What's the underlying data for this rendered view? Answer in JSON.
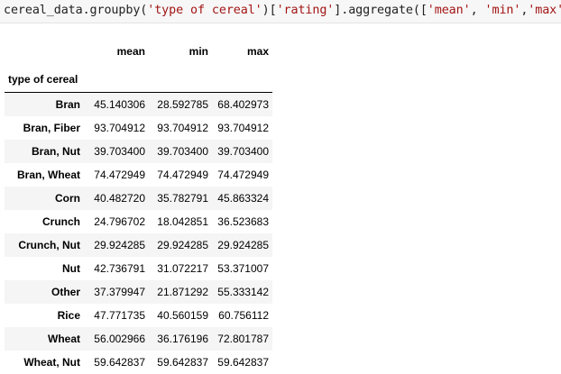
{
  "code": {
    "prefix": "cereal_data.groupby(",
    "arg1": "'type of cereal'",
    "mid1": ")[",
    "arg2": "'rating'",
    "mid2": "].aggregate([",
    "arg3": "'mean'",
    "sep1": ", ",
    "arg4": "'min'",
    "sep2": ",",
    "arg5": "'max'",
    "suffix": "])"
  },
  "table": {
    "columns": [
      "mean",
      "min",
      "max"
    ],
    "index_name": "type of cereal",
    "rows": [
      {
        "label": "Bran",
        "mean": "45.140306",
        "min": "28.592785",
        "max": "68.402973"
      },
      {
        "label": "Bran, Fiber",
        "mean": "93.704912",
        "min": "93.704912",
        "max": "93.704912"
      },
      {
        "label": "Bran, Nut",
        "mean": "39.703400",
        "min": "39.703400",
        "max": "39.703400"
      },
      {
        "label": "Bran, Wheat",
        "mean": "74.472949",
        "min": "74.472949",
        "max": "74.472949"
      },
      {
        "label": "Corn",
        "mean": "40.482720",
        "min": "35.782791",
        "max": "45.863324"
      },
      {
        "label": "Crunch",
        "mean": "24.796702",
        "min": "18.042851",
        "max": "36.523683"
      },
      {
        "label": "Crunch, Nut",
        "mean": "29.924285",
        "min": "29.924285",
        "max": "29.924285"
      },
      {
        "label": "Nut",
        "mean": "42.736791",
        "min": "31.072217",
        "max": "53.371007"
      },
      {
        "label": "Other",
        "mean": "37.379947",
        "min": "21.871292",
        "max": "55.333142"
      },
      {
        "label": "Rice",
        "mean": "47.771735",
        "min": "40.560159",
        "max": "60.756112"
      },
      {
        "label": "Wheat",
        "mean": "56.002966",
        "min": "36.176196",
        "max": "72.801787"
      },
      {
        "label": "Wheat, Nut",
        "mean": "59.642837",
        "min": "59.642837",
        "max": "59.642837"
      }
    ]
  }
}
